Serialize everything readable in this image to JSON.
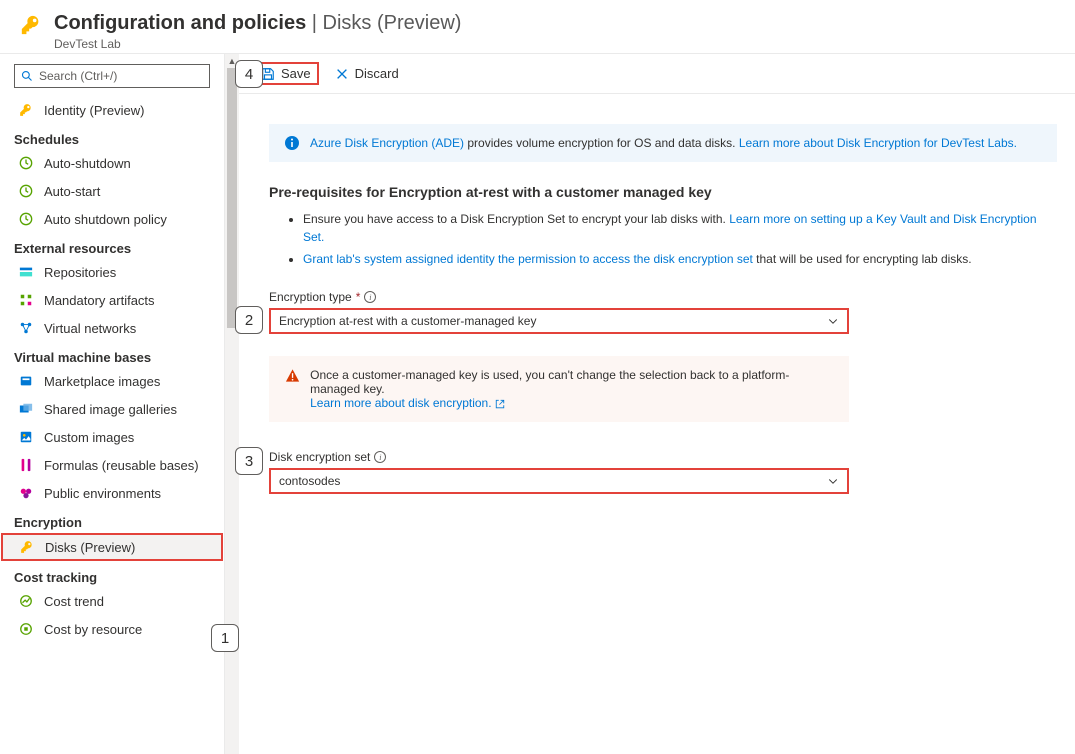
{
  "header": {
    "title_main": "Configuration and policies",
    "title_sep": " | ",
    "title_sub": "Disks (Preview)",
    "subtitle": "DevTest Lab"
  },
  "search": {
    "placeholder": "Search (Ctrl+/)"
  },
  "sidebar": {
    "identity": "Identity (Preview)",
    "schedules": {
      "label": "Schedules",
      "auto_shutdown": "Auto-shutdown",
      "auto_start": "Auto-start",
      "auto_shutdown_policy": "Auto shutdown policy"
    },
    "external": {
      "label": "External resources",
      "repositories": "Repositories",
      "mandatory_artifacts": "Mandatory artifacts",
      "virtual_networks": "Virtual networks"
    },
    "vmbases": {
      "label": "Virtual machine bases",
      "marketplace": "Marketplace images",
      "shared_galleries": "Shared image galleries",
      "custom_images": "Custom images",
      "formulas": "Formulas (reusable bases)",
      "public_envs": "Public environments"
    },
    "encryption": {
      "label": "Encryption",
      "disks": "Disks (Preview)"
    },
    "cost": {
      "label": "Cost tracking",
      "trend": "Cost trend",
      "by_resource": "Cost by resource"
    }
  },
  "toolbar": {
    "save": "Save",
    "discard": "Discard"
  },
  "banner": {
    "link1": "Azure Disk Encryption (ADE)",
    "text1": " provides volume encryption for OS and data disks. ",
    "link2": "Learn more about Disk Encryption for DevTest Labs."
  },
  "prereq": {
    "heading": "Pre-requisites for Encryption at-rest with a customer managed key",
    "li1_a": "Ensure you have access to a Disk Encryption Set to encrypt your lab disks with. ",
    "li1_link": "Learn more on setting up a Key Vault and Disk Encryption Set.",
    "li2_link": "Grant lab's system assigned identity the permission to access the disk encryption set",
    "li2_b": " that will be used for encrypting lab disks."
  },
  "fields": {
    "encryption_type_label": "Encryption type",
    "encryption_type_value": "Encryption at-rest with a customer-managed key",
    "disk_set_label": "Disk encryption set",
    "disk_set_value": "contosodes"
  },
  "warning": {
    "text": "Once a customer-managed key is used, you can't change the selection back to a platform-managed key.",
    "link": "Learn more about disk encryption."
  },
  "callouts": {
    "c1": "1",
    "c2": "2",
    "c3": "3",
    "c4": "4"
  }
}
